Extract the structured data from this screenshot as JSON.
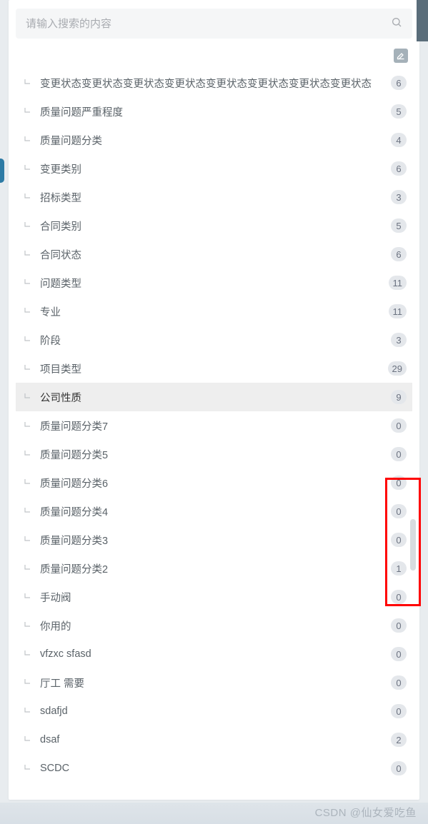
{
  "search": {
    "placeholder": "请输入搜索的内容"
  },
  "tree": {
    "items": [
      {
        "label": "变更状态变更状态变更状态变更状态变更状态变更状态变更状态变更状态",
        "count": "6",
        "selected": false
      },
      {
        "label": "质量问题严重程度",
        "count": "5",
        "selected": false
      },
      {
        "label": "质量问题分类",
        "count": "4",
        "selected": false
      },
      {
        "label": "变更类别",
        "count": "6",
        "selected": false
      },
      {
        "label": "招标类型",
        "count": "3",
        "selected": false
      },
      {
        "label": "合同类别",
        "count": "5",
        "selected": false
      },
      {
        "label": "合同状态",
        "count": "6",
        "selected": false
      },
      {
        "label": "问题类型",
        "count": "11",
        "selected": false
      },
      {
        "label": "专业",
        "count": "11",
        "selected": false
      },
      {
        "label": "阶段",
        "count": "3",
        "selected": false
      },
      {
        "label": "项目类型",
        "count": "29",
        "selected": false
      },
      {
        "label": "公司性质",
        "count": "9",
        "selected": true
      },
      {
        "label": "质量问题分类7",
        "count": "0",
        "selected": false
      },
      {
        "label": "质量问题分类5",
        "count": "0",
        "selected": false
      },
      {
        "label": "质量问题分类6",
        "count": "0",
        "selected": false
      },
      {
        "label": "质量问题分类4",
        "count": "0",
        "selected": false
      },
      {
        "label": "质量问题分类3",
        "count": "0",
        "selected": false
      },
      {
        "label": "质量问题分类2",
        "count": "1",
        "selected": false
      },
      {
        "label": "手动阀",
        "count": "0",
        "selected": false
      },
      {
        "label": "你用的",
        "count": "0",
        "selected": false
      },
      {
        "label": "vfzxc sfasd",
        "count": "0",
        "selected": false
      },
      {
        "label": "厅工 需要",
        "count": "0",
        "selected": false
      },
      {
        "label": "sdafjd",
        "count": "0",
        "selected": false
      },
      {
        "label": "dsaf",
        "count": "2",
        "selected": false
      },
      {
        "label": "SCDC",
        "count": "0",
        "selected": false
      }
    ]
  },
  "watermark": "CSDN @仙女爱吃鱼"
}
